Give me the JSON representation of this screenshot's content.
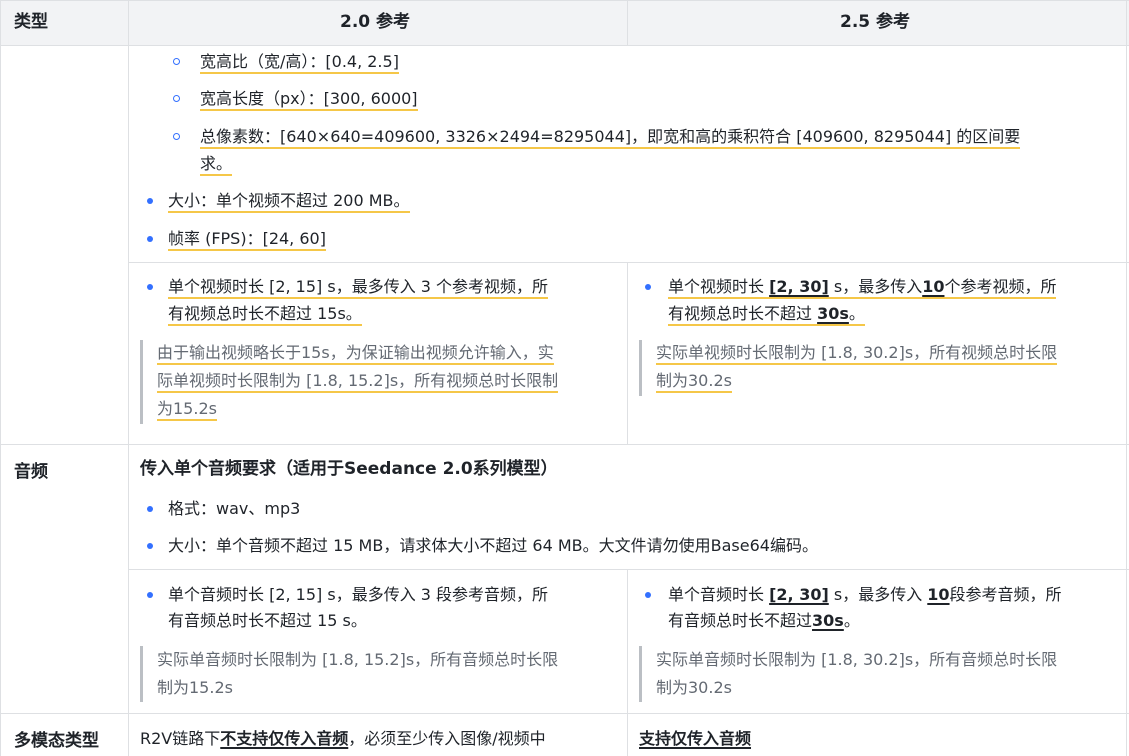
{
  "header": {
    "col_type": "类型",
    "col_20": "2.0 参考",
    "col_25": "2.5 参考"
  },
  "video": {
    "sub_aspect": "宽高比（宽/高）：[0.4, 2.5]",
    "sub_length": "宽高长度（px）：[300, 6000]",
    "sub_pixels_1": "总像素数：[640×640=409600, 3326×2494=8295044]，即宽和高的乘积符合 [409600, 8295044] 的区间要",
    "sub_pixels_2": "求。",
    "size": "大小：单个视频不超过 200 MB。",
    "fps": "帧率 (FPS)：[24, 60]",
    "v20_line1": "单个视频时长 [2, 15] s，最多传入 3 个参考视频，所",
    "v20_line2": "有视频总时长不超过 15s。",
    "v20_note_1": "由于输出视频略长于15s，为保证输出视频允许输入，实",
    "v20_note_2": "际单视频时长限制为 [1.8, 15.2]s，所有视频总时长限制",
    "v20_note_3": "为15.2s",
    "v25_a": "单个视频时长 ",
    "v25_b": "[2, 30]",
    "v25_c": " s，最多传入",
    "v25_d": "10",
    "v25_e": "个参考视频，所",
    "v25_f": "有视频总时长不超过 ",
    "v25_g": "30s",
    "v25_h": "。",
    "v25_note_1": "实际单视频时长限制为 [1.8, 30.2]s，所有视频总时长限",
    "v25_note_2": "制为30.2s"
  },
  "audio": {
    "label": "音频",
    "title": "传入单个音频要求（适用于Seedance 2.0系列模型）",
    "format": "格式：wav、mp3",
    "size": "大小：单个音频不超过 15 MB，请求体大小不超过 64 MB。大文件请勿使用Base64编码。",
    "a20_line1": "单个音频时长 [2, 15] s，最多传入 3 段参考音频，所",
    "a20_line2": "有音频总时长不超过 15 s。",
    "a20_note_1": "实际单音频时长限制为 [1.8, 15.2]s，所有音频总时长限",
    "a20_note_2": "制为15.2s",
    "a25_a": "单个音频时长 ",
    "a25_b": "[2, 30]",
    "a25_c": " s，最多传入 ",
    "a25_d": "10",
    "a25_e": "段参考音频，所",
    "a25_f": "有音频总时长不超过",
    "a25_g": "30s",
    "a25_h": "。",
    "a25_note_1": "实际单音频时长限制为 [1.8, 30.2]s，所有音频总时长限",
    "a25_note_2": "制为30.2s"
  },
  "multimodal": {
    "label": "多模态类型",
    "c20_a": "R2V链路下",
    "c20_b": "不支持仅传入音频",
    "c20_c": "，必须至少传入图像/视频中",
    "c25": "支持仅传入音频"
  },
  "colors": {
    "bullet": "#3370ff",
    "underline": "#f5c748",
    "header_bg": "#f2f3f5",
    "border": "#dee0e3"
  }
}
